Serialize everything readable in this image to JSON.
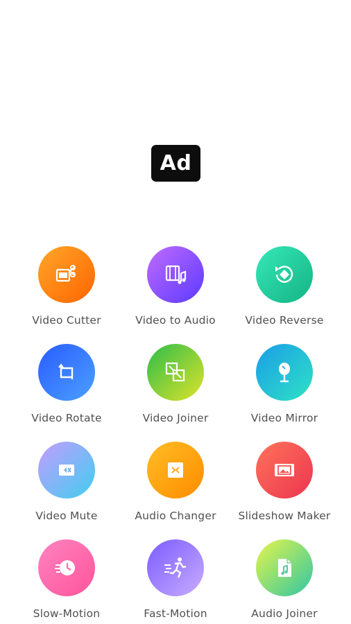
{
  "ad": {
    "label": "Ad"
  },
  "tools": [
    {
      "label": "Video Cutter",
      "icon": "scissors-film-icon",
      "gradient": [
        "#ff9a1f",
        "#ff6a00"
      ]
    },
    {
      "label": "Video to Audio",
      "icon": "film-music-icon",
      "gradient": [
        "#b05cff",
        "#6a3cff"
      ]
    },
    {
      "label": "Video Reverse",
      "icon": "reverse-icon",
      "gradient": [
        "#2de2b0",
        "#1ab98a"
      ]
    },
    {
      "label": "Video Rotate",
      "icon": "rotate-icon",
      "gradient": [
        "#2f6cff",
        "#3f8dff"
      ]
    },
    {
      "label": "Video Joiner",
      "icon": "joiner-icon",
      "gradient": [
        "#3cc24a",
        "#d4e02b"
      ]
    },
    {
      "label": "Video Mirror",
      "icon": "mirror-icon",
      "gradient": [
        "#1fa7e6",
        "#29e0c9"
      ]
    },
    {
      "label": "Video Mute",
      "icon": "mute-camera-icon",
      "gradient": [
        "#b89cff",
        "#4fc8f0"
      ]
    },
    {
      "label": "Audio Changer",
      "icon": "audio-changer-icon",
      "gradient": [
        "#ffb21f",
        "#ff8a00"
      ]
    },
    {
      "label": "Slideshow Maker",
      "icon": "slideshow-icon",
      "gradient": [
        "#ff6a55",
        "#ee3b4f"
      ]
    },
    {
      "label": "Slow-Motion",
      "icon": "slow-motion-icon",
      "gradient": [
        "#ff77b8",
        "#ff5ca0"
      ]
    },
    {
      "label": "Fast-Motion",
      "icon": "fast-motion-icon",
      "gradient": [
        "#8a6cff",
        "#c4a8ff"
      ]
    },
    {
      "label": "Audio Joiner",
      "icon": "audio-joiner-icon",
      "gradient": [
        "#d8f24c",
        "#35c9a0"
      ]
    }
  ]
}
